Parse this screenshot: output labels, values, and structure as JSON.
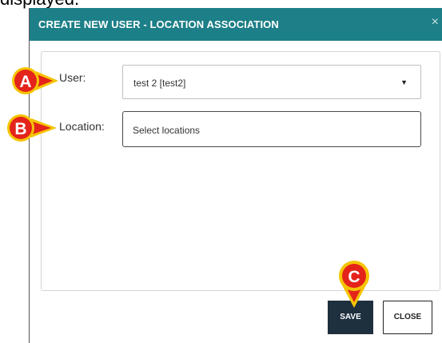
{
  "doc_text": "displayed.",
  "dialog": {
    "title": "CREATE NEW USER - LOCATION ASSOCIATION",
    "close_icon": "×"
  },
  "form": {
    "user_label": "User:",
    "user_value": "test 2 [test2]",
    "location_label": "Location:",
    "location_placeholder": "Select locations"
  },
  "buttons": {
    "save": "SAVE",
    "close": "CLOSE"
  },
  "markers": {
    "a": "A",
    "b": "B",
    "c": "C"
  },
  "colors": {
    "header": "#1d7f87",
    "save_button": "#1e2f3e",
    "marker_fill": "#e4241b",
    "marker_ring": "#f5c400"
  }
}
